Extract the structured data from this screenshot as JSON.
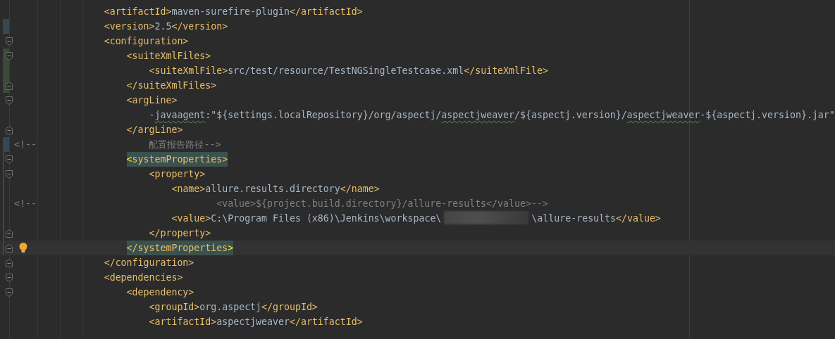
{
  "editor": {
    "lines": [
      {
        "segments": [
          {
            "kind": "tag",
            "text": "                <artifactId>"
          },
          {
            "kind": "text",
            "text": "maven-surefire-plugin"
          },
          {
            "kind": "tag",
            "text": "</artifactId>"
          }
        ]
      },
      {
        "change": {
          "kind": "wide",
          "color": "#374752"
        },
        "segments": [
          {
            "kind": "tag",
            "text": "                <version>"
          },
          {
            "kind": "text",
            "text": "2.5"
          },
          {
            "kind": "tag",
            "text": "</version>"
          }
        ]
      },
      {
        "fold": {
          "kind": "start"
        },
        "segments": [
          {
            "kind": "tag",
            "text": "                <configuration>"
          }
        ]
      },
      {
        "fold": {
          "kind": "start"
        },
        "change": {
          "kind": "wide",
          "color": "#384c38"
        },
        "segments": [
          {
            "kind": "tag",
            "text": "                    <suiteXmlFiles>"
          }
        ]
      },
      {
        "change": {
          "kind": "wide",
          "color": "#384c38"
        },
        "segments": [
          {
            "kind": "tag",
            "text": "                        <suiteXmlFile>"
          },
          {
            "kind": "text",
            "text": "src/test/resource/TestNGSingleTestcase.xml"
          },
          {
            "kind": "tag",
            "text": "</suiteXmlFile>"
          }
        ]
      },
      {
        "fold": {
          "kind": "end"
        },
        "change": {
          "kind": "wide",
          "color": "#384c38"
        },
        "segments": [
          {
            "kind": "tag",
            "text": "                    </suiteXmlFiles>"
          }
        ]
      },
      {
        "fold": {
          "kind": "start"
        },
        "segments": [
          {
            "kind": "tag",
            "text": "                    <argLine>"
          }
        ]
      },
      {
        "segments": [
          {
            "kind": "text",
            "text": "                        -"
          },
          {
            "kind": "text",
            "typo": true,
            "text": "javaagent"
          },
          {
            "kind": "text",
            "text": ":\"${settings.localRepository}/org/aspectj/"
          },
          {
            "kind": "text",
            "typo": true,
            "text": "aspectjweaver"
          },
          {
            "kind": "text",
            "text": "/${aspectj.version}/"
          },
          {
            "kind": "text",
            "typo": true,
            "text": "aspectjweaver"
          },
          {
            "kind": "text",
            "text": "-${aspectj.version}.jar\""
          }
        ]
      },
      {
        "fold": {
          "kind": "end"
        },
        "segments": [
          {
            "kind": "tag",
            "text": "                    </argLine>"
          }
        ]
      },
      {
        "change": {
          "kind": "wide",
          "color": "#374752"
        },
        "segments": [
          {
            "kind": "comment",
            "text": "<!--                    配置报告路径-->"
          }
        ]
      },
      {
        "fold": {
          "kind": "start"
        },
        "change": {
          "kind": "thin",
          "color": "#374752"
        },
        "segments": [
          {
            "kind": "brace",
            "text": "                    <"
          },
          {
            "kind": "tag",
            "highlight": true,
            "text": "systemProperties>"
          }
        ]
      },
      {
        "fold": {
          "kind": "start"
        },
        "change": {
          "kind": "thin",
          "color": "#374752"
        },
        "segments": [
          {
            "kind": "tag",
            "text": "                        <property>"
          }
        ]
      },
      {
        "change": {
          "kind": "thin",
          "color": "#374752"
        },
        "segments": [
          {
            "kind": "tag",
            "text": "                            <name>"
          },
          {
            "kind": "text",
            "text": "allure.results.directory"
          },
          {
            "kind": "tag",
            "text": "</name>"
          }
        ]
      },
      {
        "change": {
          "kind": "thin",
          "color": "#374752"
        },
        "segments": [
          {
            "kind": "comment",
            "text": "<!--                                <value>${project.build.directory}/allure-results</value>-->"
          }
        ]
      },
      {
        "change": {
          "kind": "thin",
          "color": "#374752"
        },
        "segments": [
          {
            "kind": "tag",
            "text": "                            <value>"
          },
          {
            "kind": "text",
            "text": "C:\\Program Files (x86)\\Jenkins\\workspace\\"
          },
          {
            "kind": "redacted"
          },
          {
            "kind": "text",
            "text": "\\allure-results"
          },
          {
            "kind": "tag",
            "text": "</value>"
          }
        ]
      },
      {
        "fold": {
          "kind": "end"
        },
        "change": {
          "kind": "thin",
          "color": "#374752"
        },
        "segments": [
          {
            "kind": "tag",
            "text": "                        </property>"
          }
        ]
      },
      {
        "fold": {
          "kind": "end"
        },
        "change": {
          "kind": "thin",
          "color": "#374752"
        },
        "current": true,
        "bulb": true,
        "segments": [
          {
            "kind": "tag",
            "highlight": true,
            "text": "                    </systemProperties"
          },
          {
            "kind": "brace",
            "text": ">"
          }
        ]
      },
      {
        "fold": {
          "kind": "end"
        },
        "segments": [
          {
            "kind": "tag",
            "text": "                </configuration>"
          }
        ]
      },
      {
        "fold": {
          "kind": "start"
        },
        "segments": [
          {
            "kind": "tag",
            "text": "                <dependencies>"
          }
        ]
      },
      {
        "fold": {
          "kind": "start"
        },
        "segments": [
          {
            "kind": "tag",
            "text": "                    <dependency>"
          }
        ]
      },
      {
        "segments": [
          {
            "kind": "tag",
            "text": "                        <groupId>"
          },
          {
            "kind": "text",
            "text": "org.aspectj"
          },
          {
            "kind": "tag",
            "text": "</groupId>"
          }
        ]
      },
      {
        "segments": [
          {
            "kind": "tag",
            "text": "                        <artifactId>"
          },
          {
            "kind": "text",
            "text": "aspectjweaver"
          },
          {
            "kind": "tag",
            "text": "</artifactId>"
          }
        ]
      }
    ]
  }
}
